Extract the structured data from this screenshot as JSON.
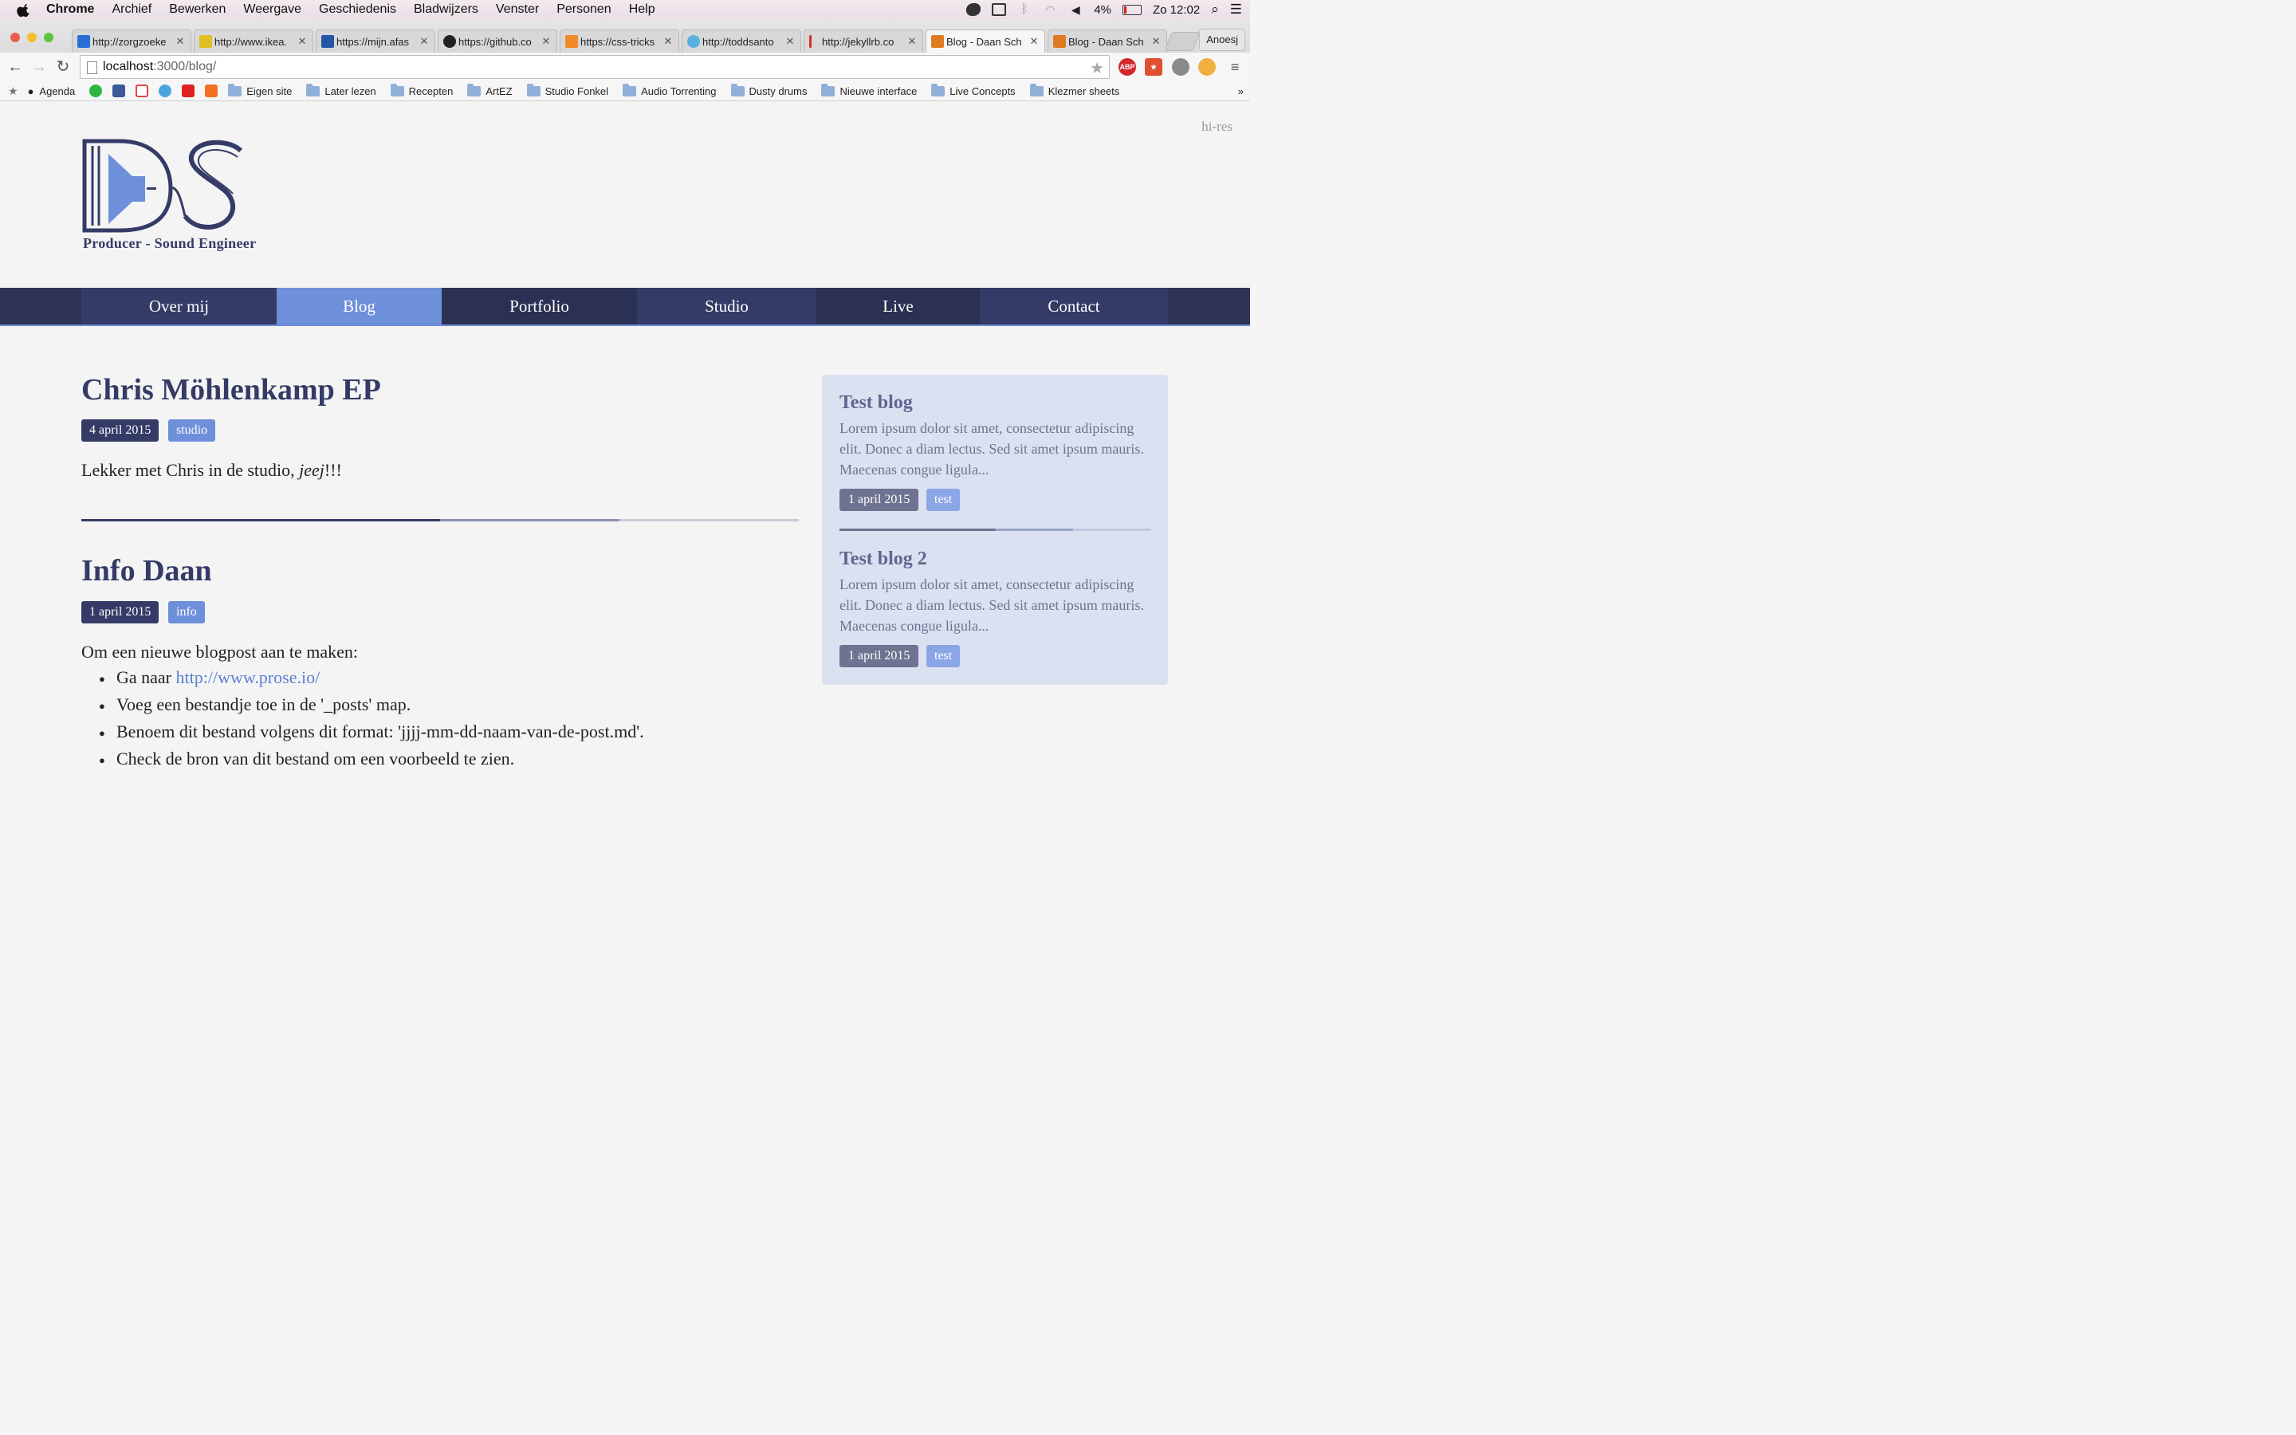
{
  "menubar": {
    "app": "Chrome",
    "items": [
      "Archief",
      "Bewerken",
      "Weergave",
      "Geschiedenis",
      "Bladwijzers",
      "Venster",
      "Personen",
      "Help"
    ],
    "battery": "4%",
    "clock": "Zo 12:02"
  },
  "tabs": [
    {
      "title": "http://zorgzoeke",
      "icon_color": "#2a6fd6"
    },
    {
      "title": "http://www.ikea.",
      "icon_color": "#e0c020"
    },
    {
      "title": "https://mijn.afas",
      "icon_color": "#2456a8"
    },
    {
      "title": "https://github.co",
      "icon_color": "#222222"
    },
    {
      "title": "https://css-tricks",
      "icon_color": "#f08a24"
    },
    {
      "title": "http://toddsanto",
      "icon_color": "#5ab0e0"
    },
    {
      "title": "http://jekyllrb.co",
      "icon_color": "#d03030"
    },
    {
      "title": "Blog - Daan Sch",
      "icon_color": "#e07a20"
    },
    {
      "title": "Blog - Daan Sch",
      "icon_color": "#e07a20"
    }
  ],
  "profile_name": "Anoesj",
  "omnibox": {
    "host": "localhost",
    "rest": ":3000/blog/"
  },
  "bookmarks": {
    "apps": [
      {
        "label": "Agenda"
      }
    ],
    "folders": [
      "Eigen site",
      "Later lezen",
      "Recepten",
      "ArtEZ",
      "Studio Fonkel",
      "Audio Torrenting",
      "Dusty drums",
      "Nieuwe interface",
      "Live Concepts",
      "Klezmer sheets"
    ],
    "overflow": "»"
  },
  "site": {
    "hires_link": "hi-res",
    "tagline": "Producer - Sound Engineer",
    "nav": [
      "Over mij",
      "Blog",
      "Portfolio",
      "Studio",
      "Live",
      "Contact"
    ],
    "active_nav": "Blog",
    "colors": {
      "navy": "#343b66",
      "accent": "#6e90db",
      "sidebar": "#dbe1f0"
    }
  },
  "posts": [
    {
      "title": "Chris Möhlenkamp EP",
      "date": "4 april 2015",
      "tag": "studio",
      "body_before": "Lekker met Chris in de studio, ",
      "body_em": "jeej",
      "body_after": "!!!"
    },
    {
      "title": "Info Daan",
      "date": "1 april 2015",
      "tag": "info",
      "intro": "Om een nieuwe blogpost aan te maken:",
      "list": {
        "item1_prefix": "Ga naar ",
        "item1_link": "http://www.prose.io/",
        "item2": "Voeg een bestandje toe in de '_posts' map.",
        "item3": "Benoem dit bestand volgens dit format: 'jjjj-mm-dd-naam-van-de-post.md'.",
        "item4": "Check de bron van dit bestand om een voorbeeld te zien."
      }
    }
  ],
  "sidebar": [
    {
      "title": "Test blog",
      "excerpt": "Lorem ipsum dolor sit amet, consectetur adipiscing elit. Donec a diam lectus. Sed sit amet ipsum mauris. Maecenas congue ligula...",
      "date": "1 april 2015",
      "tag": "test"
    },
    {
      "title": "Test blog 2",
      "excerpt": "Lorem ipsum dolor sit amet, consectetur adipiscing elit. Donec a diam lectus. Sed sit amet ipsum mauris. Maecenas congue ligula...",
      "date": "1 april 2015",
      "tag": "test"
    }
  ]
}
